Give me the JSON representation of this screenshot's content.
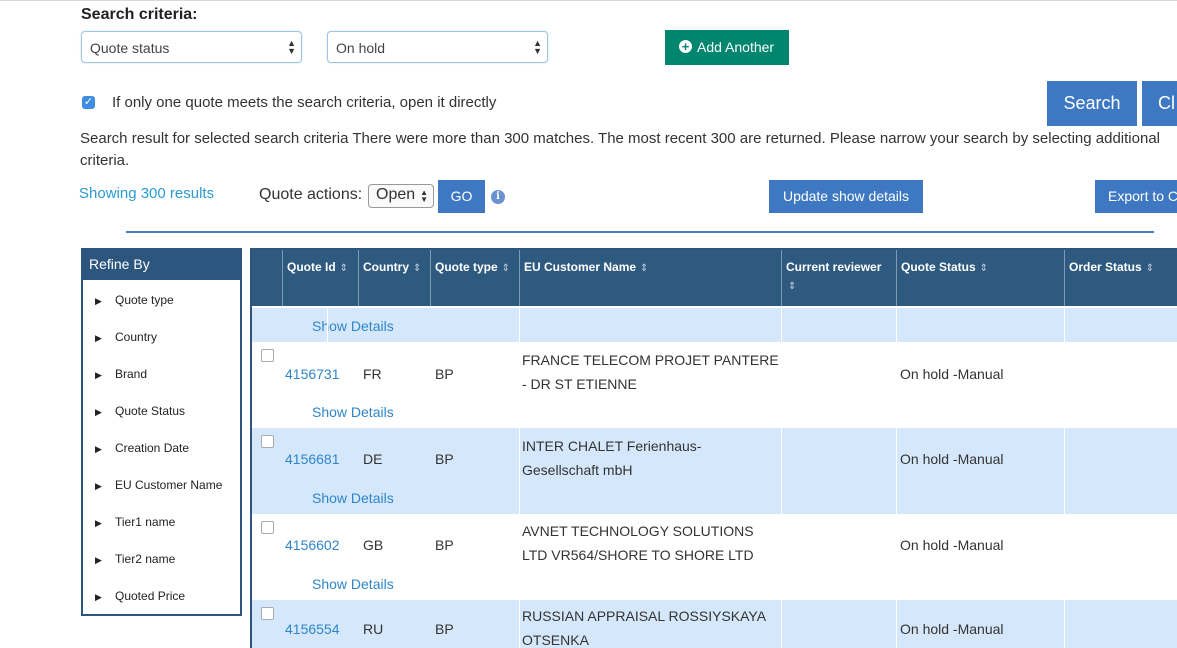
{
  "search": {
    "label": "Search criteria:",
    "field_select": "Quote status",
    "value_select": "On hold",
    "add_another": "Add Another",
    "open_direct_label": "If only one quote meets the search criteria, open it directly",
    "search_button": "Search",
    "clear_button": "Cl"
  },
  "result_message": "Search result for selected search criteria There were more than 300 matches. The most recent 300 are returned. Please narrow your search by selecting additional criteria.",
  "toolbar": {
    "showing": "Showing 300 results",
    "quote_actions_label": "Quote actions:",
    "quote_actions_value": "Open",
    "go_button": "GO",
    "info_icon_glyph": "i",
    "update_button": "Update show details",
    "export_button": "Export to C"
  },
  "refine": {
    "title": "Refine By",
    "items": [
      "Quote type",
      "Country",
      "Brand",
      "Quote Status",
      "Creation Date",
      "EU Customer Name",
      "Tier1 name",
      "Tier2 name",
      "Quoted Price"
    ]
  },
  "table": {
    "columns": [
      "Quote Id",
      "Country",
      "Quote type",
      "EU Customer Name",
      "Current reviewer",
      "Quote Status",
      "Order Status"
    ],
    "show_details": "Show Details",
    "rows": [
      {
        "id": "4156731",
        "country": "FR",
        "type": "BP",
        "customer_line1": "FRANCE TELECOM PROJET PANTERE",
        "customer_line2": "- DR ST ETIENNE",
        "reviewer": "",
        "status": "On hold -Manual",
        "order": ""
      },
      {
        "id": "4156681",
        "country": "DE",
        "type": "BP",
        "customer_line1": "INTER CHALET Ferienhaus-",
        "customer_line2": "Gesellschaft mbH",
        "reviewer": "",
        "status": "On hold -Manual",
        "order": ""
      },
      {
        "id": "4156602",
        "country": "GB",
        "type": "BP",
        "customer_line1": "AVNET TECHNOLOGY SOLUTIONS",
        "customer_line2": "LTD VR564/SHORE TO SHORE LTD",
        "reviewer": "",
        "status": "On hold -Manual",
        "order": ""
      },
      {
        "id": "4156554",
        "country": "RU",
        "type": "BP",
        "customer_line1": "RUSSIAN APPRAISAL ROSSIYSKAYA",
        "customer_line2": "OTSENKA",
        "reviewer": "",
        "status": "On hold -Manual",
        "order": ""
      }
    ]
  },
  "colors": {
    "accent": "#3e78c2",
    "green": "#00856f",
    "header": "#2f5a80",
    "row_highlight": "#d5e8fb",
    "link": "#2f85c9"
  }
}
